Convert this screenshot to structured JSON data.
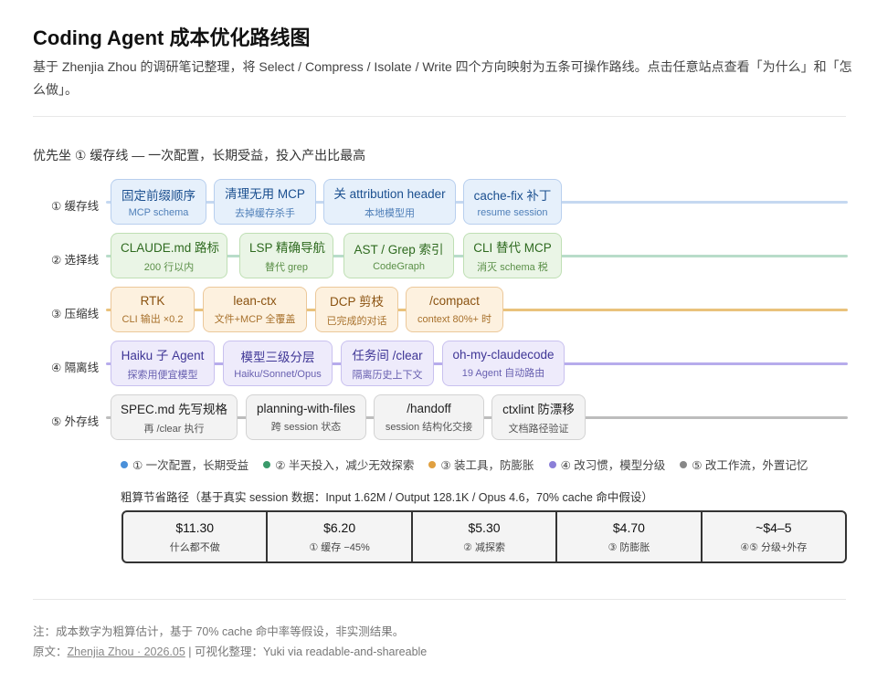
{
  "header": {
    "title": "Coding Agent 成本优化路线图",
    "subtitle": "基于 Zhenjia Zhou 的调研笔记整理，将 Select / Compress / Isolate / Write 四个方向映射为五条可操作路线。点击任意站点查看「为什么」和「怎么做」。"
  },
  "priority": "优先坐 ① 缓存线 — 一次配置，长期受益，投入产出比最高",
  "lines": [
    {
      "label": "① 缓存线",
      "color": "#4a90d9",
      "stations": [
        {
          "title": "固定前缀顺序",
          "sub": "MCP schema"
        },
        {
          "title": "清理无用 MCP",
          "sub": "去掉缓存杀手"
        },
        {
          "title": "关 attribution header",
          "sub": "本地模型用"
        },
        {
          "title": "cache-fix 补丁",
          "sub": "resume session"
        }
      ]
    },
    {
      "label": "② 选择线",
      "color": "#3a9a6a",
      "stations": [
        {
          "title": "CLAUDE.md 路标",
          "sub": "200 行以内"
        },
        {
          "title": "LSP 精确导航",
          "sub": "替代 grep"
        },
        {
          "title": "AST / Grep 索引",
          "sub": "CodeGraph"
        },
        {
          "title": "CLI 替代 MCP",
          "sub": "消灭 schema 税"
        }
      ]
    },
    {
      "label": "③ 压缩线",
      "color": "#e0a040",
      "stations": [
        {
          "title": "RTK",
          "sub": "CLI 输出 ×0.2"
        },
        {
          "title": "lean-ctx",
          "sub": "文件+MCP 全覆盖"
        },
        {
          "title": "DCP 剪枝",
          "sub": "已完成的对话"
        },
        {
          "title": "/compact",
          "sub": "context 80%+ 时"
        }
      ]
    },
    {
      "label": "④ 隔离线",
      "color": "#8b7fd8",
      "stations": [
        {
          "title": "Haiku 子 Agent",
          "sub": "探索用便宜模型"
        },
        {
          "title": "模型三级分层",
          "sub": "Haiku/Sonnet/Opus"
        },
        {
          "title": "任务间 /clear",
          "sub": "隔离历史上下文"
        },
        {
          "title": "oh-my-claudecode",
          "sub": "19 Agent 自动路由"
        }
      ]
    },
    {
      "label": "⑤ 外存线",
      "color": "#888888",
      "stations": [
        {
          "title": "SPEC.md 先写规格",
          "sub": "再 /clear 执行"
        },
        {
          "title": "planning-with-files",
          "sub": "跨 session 状态"
        },
        {
          "title": "/handoff",
          "sub": "session 结构化交接"
        },
        {
          "title": "ctxlint 防漂移",
          "sub": "文档路径验证"
        }
      ]
    }
  ],
  "legend": [
    {
      "text": "① 一次配置，长期受益",
      "color": "#4a90d9"
    },
    {
      "text": "② 半天投入，减少无效探索",
      "color": "#3a9a6a"
    },
    {
      "text": "③ 装工具，防膨胀",
      "color": "#e0a040"
    },
    {
      "text": "④ 改习惯，模型分级",
      "color": "#8b7fd8"
    },
    {
      "text": "⑤ 改工作流，外置记忆",
      "color": "#888888"
    }
  ],
  "savings": {
    "title": "粗算节省路径（基于真实 session 数据：Input 1.62M / Output 128.1K / Opus 4.6，70% cache 命中假设）",
    "cells": [
      {
        "value": "$11.30",
        "label": "什么都不做"
      },
      {
        "value": "$6.20",
        "label": "① 缓存 −45%"
      },
      {
        "value": "$5.30",
        "label": "② 减探索"
      },
      {
        "value": "$4.70",
        "label": "③ 防膨胀"
      },
      {
        "value": "~$4–5",
        "label": "④⑤ 分级+外存"
      }
    ]
  },
  "footer": {
    "note": "注：成本数字为粗算估计，基于 70% cache 命中率等假设，非实测结果。",
    "source_prefix": "原文：",
    "source_link": "Zhenjia Zhou · 2026.05",
    "source_suffix": " | 可视化整理：Yuki via readable-and-shareable"
  }
}
